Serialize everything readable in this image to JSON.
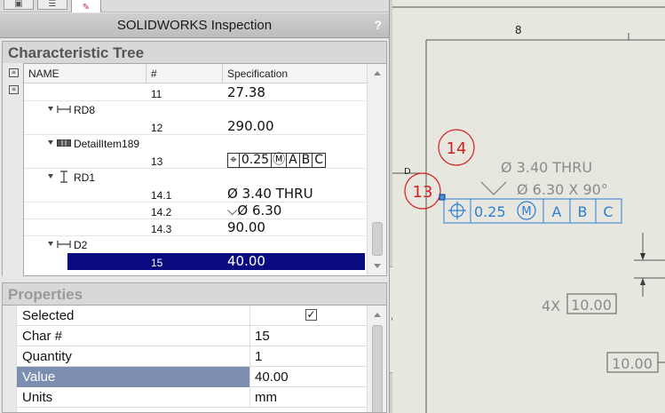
{
  "panel": {
    "title": "SOLIDWORKS Inspection",
    "help": "?",
    "tabs": [
      {
        "icon": "folder-icon"
      },
      {
        "icon": "list-icon"
      },
      {
        "icon": "characteristic-icon"
      }
    ]
  },
  "tree": {
    "title": "Characteristic Tree",
    "columns": [
      "NAME",
      "#",
      "Specification"
    ],
    "rows": [
      {
        "kind": "item",
        "num": "11",
        "spec": "27.38"
      },
      {
        "kind": "node",
        "label": "RD8",
        "icon": "linear-dimension-icon"
      },
      {
        "kind": "item",
        "num": "12",
        "spec": "290.00"
      },
      {
        "kind": "node",
        "label": "DetailItem189",
        "icon": "feature-control-frame-icon"
      },
      {
        "kind": "item",
        "num": "13",
        "spec_parts": [
          "⌖",
          "0.25",
          "Ⓜ",
          "A",
          "B",
          "C"
        ]
      },
      {
        "kind": "node",
        "label": "RD1",
        "icon": "hole-dimension-icon"
      },
      {
        "kind": "item",
        "num": "14.1",
        "spec": "Ø 3.40  THRU"
      },
      {
        "kind": "item",
        "num": "14.2",
        "spec": "⌵Ø 6.30"
      },
      {
        "kind": "item",
        "num": "14.3",
        "spec": "90.00"
      },
      {
        "kind": "node",
        "label": "D2",
        "icon": "linear-dimension-icon"
      },
      {
        "kind": "item",
        "num": "15",
        "spec": "40.00",
        "selected": true
      }
    ]
  },
  "properties": {
    "title": "Properties",
    "rows": [
      {
        "name": "Selected",
        "value": "✓",
        "checkbox": true
      },
      {
        "name": "Char #",
        "value": "15"
      },
      {
        "name": "Quantity",
        "value": "1"
      },
      {
        "name": "Value",
        "value": "40.00",
        "highlight": true
      },
      {
        "name": "Units",
        "value": "mm"
      }
    ]
  },
  "drawing": {
    "column_number": "8",
    "row_letter": "D",
    "balloons": [
      "14",
      "13"
    ],
    "hole_callout": "Ø 3.40 THRU",
    "csk_callout": "Ø 6.30 X 90°",
    "fcf": [
      "0.25",
      "M",
      "A",
      "B",
      "C"
    ],
    "pattern_prefix": "4X",
    "dim_boxed_1": "10.00",
    "dim_boxed_2": "10.00",
    "colors": {
      "balloon": "#d42020",
      "annotation": "#2a7fd4",
      "selection": "#0a0a80"
    }
  }
}
